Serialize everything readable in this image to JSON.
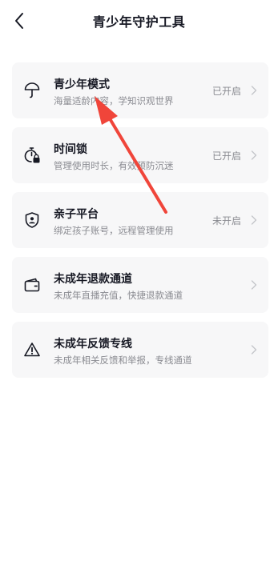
{
  "header": {
    "title": "青少年守护工具"
  },
  "cards": [
    {
      "icon": "umbrella-icon",
      "title": "青少年模式",
      "description": "海量适龄内容，学知识观世界",
      "status": "已开启"
    },
    {
      "icon": "timer-lock-icon",
      "title": "时间锁",
      "description": "管理使用时长，有效预防沉迷",
      "status": "已开启"
    },
    {
      "icon": "parent-shield-icon",
      "title": "亲子平台",
      "description": "绑定孩子账号，远程管理使用",
      "status": "未开启"
    },
    {
      "icon": "wallet-icon",
      "title": "未成年退款通道",
      "description": "未成年直播充值，快捷退款通道",
      "status": ""
    },
    {
      "icon": "warning-icon",
      "title": "未成年反馈专线",
      "description": "未成年相关反馈和举报，专线通道",
      "status": ""
    }
  ],
  "colors": {
    "background": "#ffffff",
    "card_background": "#f7f7f8",
    "title_text": "#161823",
    "secondary_text": "#8a8b91",
    "annotation_arrow": "#f0453a"
  }
}
